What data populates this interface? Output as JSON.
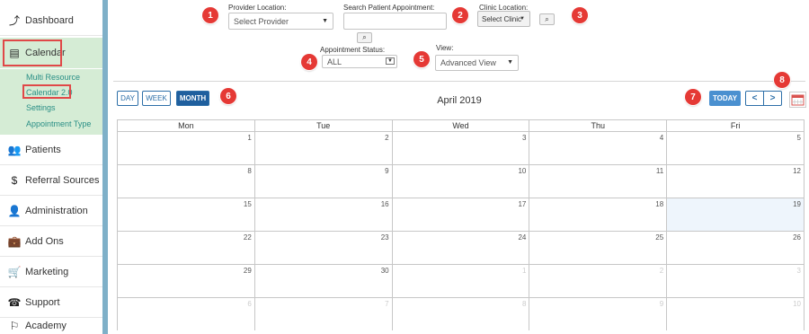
{
  "sidebar": {
    "items": [
      {
        "name": "dashboard",
        "label": "Dashboard",
        "icon": "chart-line-icon",
        "glyph": "⤴"
      },
      {
        "name": "calendar",
        "label": "Calendar",
        "icon": "calendar-icon",
        "glyph": "▤"
      },
      {
        "name": "patients",
        "label": "Patients",
        "icon": "users-icon",
        "glyph": "👥"
      },
      {
        "name": "referral-sources",
        "label": "Referral Sources",
        "icon": "dollar-icon",
        "glyph": "$"
      },
      {
        "name": "administration",
        "label": "Administration",
        "icon": "user-icon",
        "glyph": "👤"
      },
      {
        "name": "add-ons",
        "label": "Add Ons",
        "icon": "briefcase-icon",
        "glyph": "💼"
      },
      {
        "name": "marketing",
        "label": "Marketing",
        "icon": "cart-icon",
        "glyph": "🛒"
      },
      {
        "name": "support",
        "label": "Support",
        "icon": "phone-icon",
        "glyph": "☎"
      },
      {
        "name": "academy",
        "label": "Academy",
        "icon": "academy-icon",
        "glyph": "⚐"
      }
    ],
    "calendar_sub": [
      "Multi Resource",
      "Calendar 2.0",
      "Settings",
      "Appointment Type"
    ]
  },
  "filters": {
    "provider_label": "Provider Location:",
    "provider_value": "Select Provider",
    "search_label": "Search Patient Appointment:",
    "clinic_label": "Clinic Location:",
    "clinic_value": "Select Clinic",
    "status_label": "Appointment Status:",
    "status_value": "ALL",
    "view_label": "View:",
    "view_value": "Advanced View"
  },
  "badges": [
    "1",
    "2",
    "3",
    "4",
    "5",
    "6",
    "7",
    "8"
  ],
  "toolbar": {
    "day": "DAY",
    "week": "WEEK",
    "month": "MONTH",
    "title": "April 2019",
    "today": "TODAY",
    "prev": "<",
    "next": ">"
  },
  "calendar": {
    "weekdays": [
      "Mon",
      "Tue",
      "Wed",
      "Thu",
      "Fri"
    ],
    "weeks": [
      [
        "1",
        "2",
        "3",
        "4",
        "5"
      ],
      [
        "8",
        "9",
        "10",
        "11",
        "12"
      ],
      [
        "15",
        "16",
        "17",
        "18",
        "19"
      ],
      [
        "22",
        "23",
        "24",
        "25",
        "26"
      ],
      [
        "29",
        "30",
        "1",
        "2",
        "3"
      ],
      [
        "6",
        "7",
        "8",
        "9",
        "10"
      ]
    ]
  },
  "colors": {
    "accent": "#1f5f9e",
    "badge": "#e53935",
    "highlight": "#d5ecd5"
  }
}
